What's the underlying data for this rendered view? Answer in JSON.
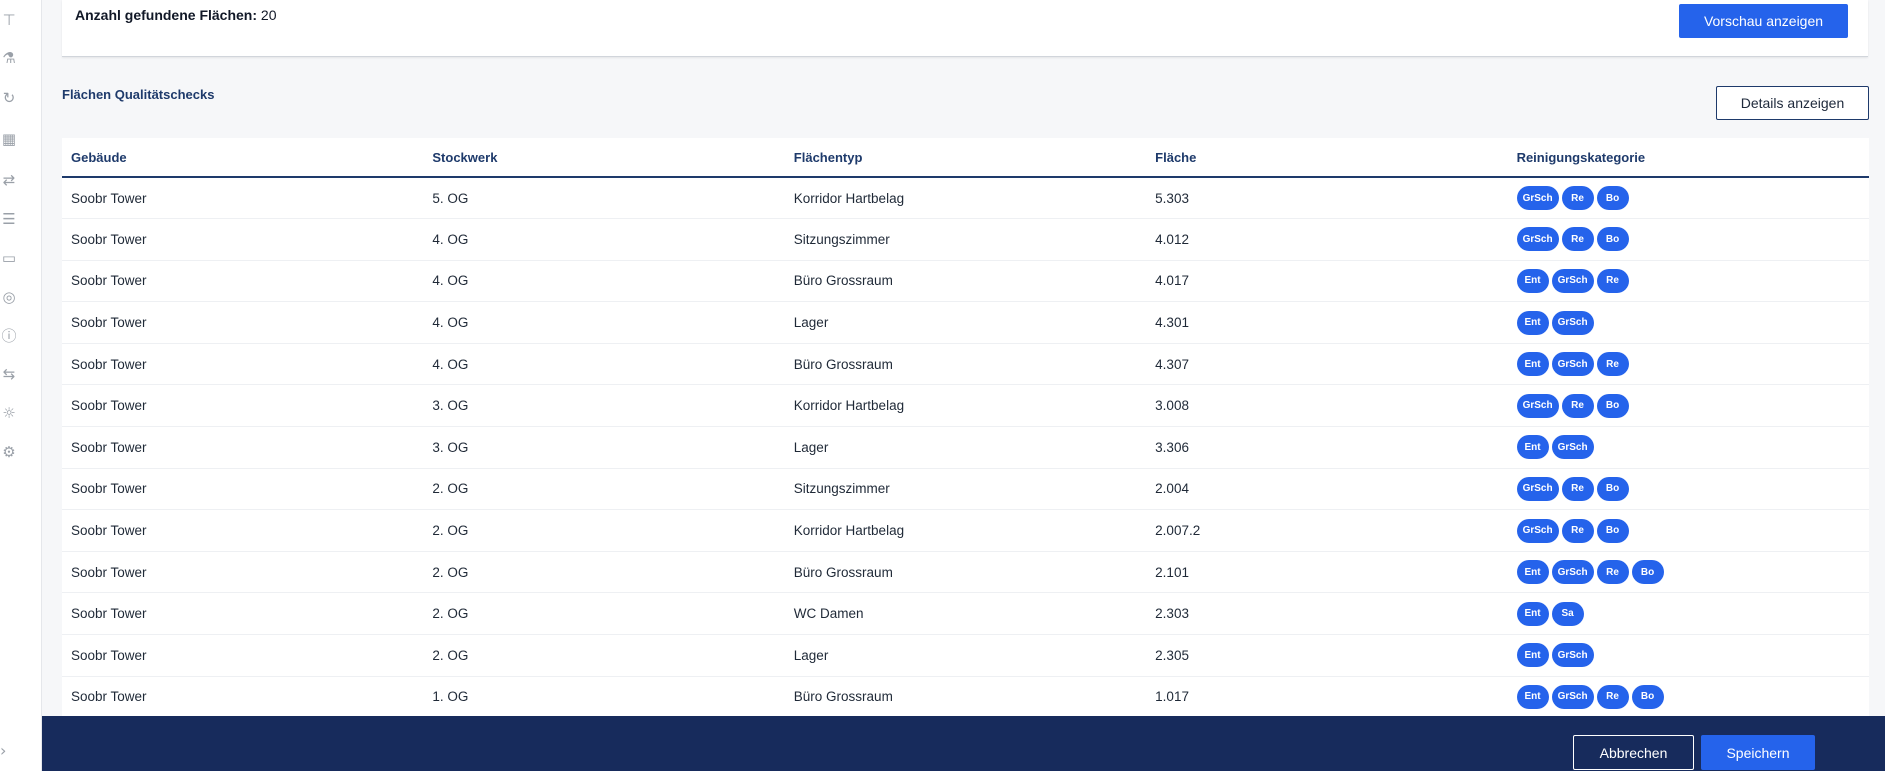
{
  "summary": {
    "count_label": "Anzahl gefundene Flächen:",
    "count_value": "20",
    "preview_button": "Vorschau anzeigen"
  },
  "section": {
    "title": "Flächen Qualitätschecks",
    "details_button": "Details anzeigen"
  },
  "sidebar": {
    "icons": [
      "sitemap-icon",
      "flask-icon",
      "cycle-icon",
      "calendar-clock-icon",
      "transfer-icon",
      "list-building-icon",
      "monitor-icon",
      "target-icon",
      "alert-icon",
      "translate-icon",
      "bulb-icon",
      "gear-icon"
    ],
    "expand_icon": "chevron-right-icon"
  },
  "table": {
    "columns": [
      "Gebäude",
      "Stockwerk",
      "Flächentyp",
      "Fläche",
      "Reinigungskategorie"
    ],
    "rows": [
      {
        "building": "Soobr Tower",
        "floor": "5. OG",
        "type": "Korridor Hartbelag",
        "area": "5.303",
        "categories": [
          "GrSch",
          "Re",
          "Bo"
        ]
      },
      {
        "building": "Soobr Tower",
        "floor": "4. OG",
        "type": "Sitzungszimmer",
        "area": "4.012",
        "categories": [
          "GrSch",
          "Re",
          "Bo"
        ]
      },
      {
        "building": "Soobr Tower",
        "floor": "4. OG",
        "type": "Büro Grossraum",
        "area": "4.017",
        "categories": [
          "Ent",
          "GrSch",
          "Re"
        ]
      },
      {
        "building": "Soobr Tower",
        "floor": "4. OG",
        "type": "Lager",
        "area": "4.301",
        "categories": [
          "Ent",
          "GrSch"
        ]
      },
      {
        "building": "Soobr Tower",
        "floor": "4. OG",
        "type": "Büro Grossraum",
        "area": "4.307",
        "categories": [
          "Ent",
          "GrSch",
          "Re"
        ]
      },
      {
        "building": "Soobr Tower",
        "floor": "3. OG",
        "type": "Korridor Hartbelag",
        "area": "3.008",
        "categories": [
          "GrSch",
          "Re",
          "Bo"
        ]
      },
      {
        "building": "Soobr Tower",
        "floor": "3. OG",
        "type": "Lager",
        "area": "3.306",
        "categories": [
          "Ent",
          "GrSch"
        ]
      },
      {
        "building": "Soobr Tower",
        "floor": "2. OG",
        "type": "Sitzungszimmer",
        "area": "2.004",
        "categories": [
          "GrSch",
          "Re",
          "Bo"
        ]
      },
      {
        "building": "Soobr Tower",
        "floor": "2. OG",
        "type": "Korridor Hartbelag",
        "area": "2.007.2",
        "categories": [
          "GrSch",
          "Re",
          "Bo"
        ]
      },
      {
        "building": "Soobr Tower",
        "floor": "2. OG",
        "type": "Büro Grossraum",
        "area": "2.101",
        "categories": [
          "Ent",
          "GrSch",
          "Re",
          "Bo"
        ]
      },
      {
        "building": "Soobr Tower",
        "floor": "2. OG",
        "type": "WC Damen",
        "area": "2.303",
        "categories": [
          "Ent",
          "Sa"
        ]
      },
      {
        "building": "Soobr Tower",
        "floor": "2. OG",
        "type": "Lager",
        "area": "2.305",
        "categories": [
          "Ent",
          "GrSch"
        ]
      },
      {
        "building": "Soobr Tower",
        "floor": "1. OG",
        "type": "Büro Grossraum",
        "area": "1.017",
        "categories": [
          "Ent",
          "GrSch",
          "Re",
          "Bo"
        ]
      }
    ]
  },
  "footer": {
    "cancel_button": "Abbrechen",
    "save_button": "Speichern"
  },
  "colors": {
    "primary": "#2563eb",
    "navy": "#172b5c",
    "heading": "#1e3a6b"
  }
}
